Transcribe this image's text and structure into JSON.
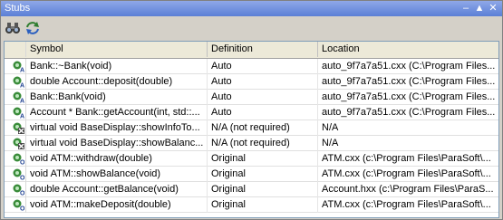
{
  "window": {
    "title": "Stubs"
  },
  "titlebar": {
    "pin_glyph": "⮛",
    "auto_glyph": "⇓",
    "close_glyph": "✖"
  },
  "toolbar": {
    "find_icon": "binoculars-icon",
    "sync_icon": "refresh-icon"
  },
  "columns": [
    "",
    "Symbol",
    "Definition",
    "Location"
  ],
  "rows": [
    {
      "icon": "auto-stub-icon",
      "symbol": "Bank::~Bank(void)",
      "definition": "Auto",
      "location": "auto_9f7a7a51.cxx  (C:\\Program Files..."
    },
    {
      "icon": "auto-stub-icon",
      "symbol": "double Account::deposit(double)",
      "definition": "Auto",
      "location": "auto_9f7a7a51.cxx  (C:\\Program Files..."
    },
    {
      "icon": "auto-stub-icon",
      "symbol": "Bank::Bank(void)",
      "definition": "Auto",
      "location": "auto_9f7a7a51.cxx  (C:\\Program Files..."
    },
    {
      "icon": "auto-stub-icon",
      "symbol": "Account * Bank::getAccount(int, std::...",
      "definition": "Auto",
      "location": "auto_9f7a7a51.cxx  (C:\\Program Files..."
    },
    {
      "icon": "not-required-icon",
      "symbol": "virtual void BaseDisplay::showInfoTo...",
      "definition": "N/A (not required)",
      "location": "N/A"
    },
    {
      "icon": "not-required-icon",
      "symbol": "virtual void BaseDisplay::showBalanc...",
      "definition": "N/A (not required)",
      "location": "N/A"
    },
    {
      "icon": "original-stub-icon",
      "symbol": "void ATM::withdraw(double)",
      "definition": "Original",
      "location": "ATM.cxx  (c:\\Program Files\\ParaSoft\\..."
    },
    {
      "icon": "original-stub-icon",
      "symbol": "void ATM::showBalance(void)",
      "definition": "Original",
      "location": "ATM.cxx  (c:\\Program Files\\ParaSoft\\..."
    },
    {
      "icon": "original-stub-icon",
      "symbol": "double Account::getBalance(void)",
      "definition": "Original",
      "location": "Account.hxx  (c:\\Program Files\\ParaS..."
    },
    {
      "icon": "original-stub-icon",
      "symbol": "void ATM::makeDeposit(double)",
      "definition": "Original",
      "location": "ATM.cxx  (c:\\Program Files\\ParaSoft\\..."
    }
  ]
}
